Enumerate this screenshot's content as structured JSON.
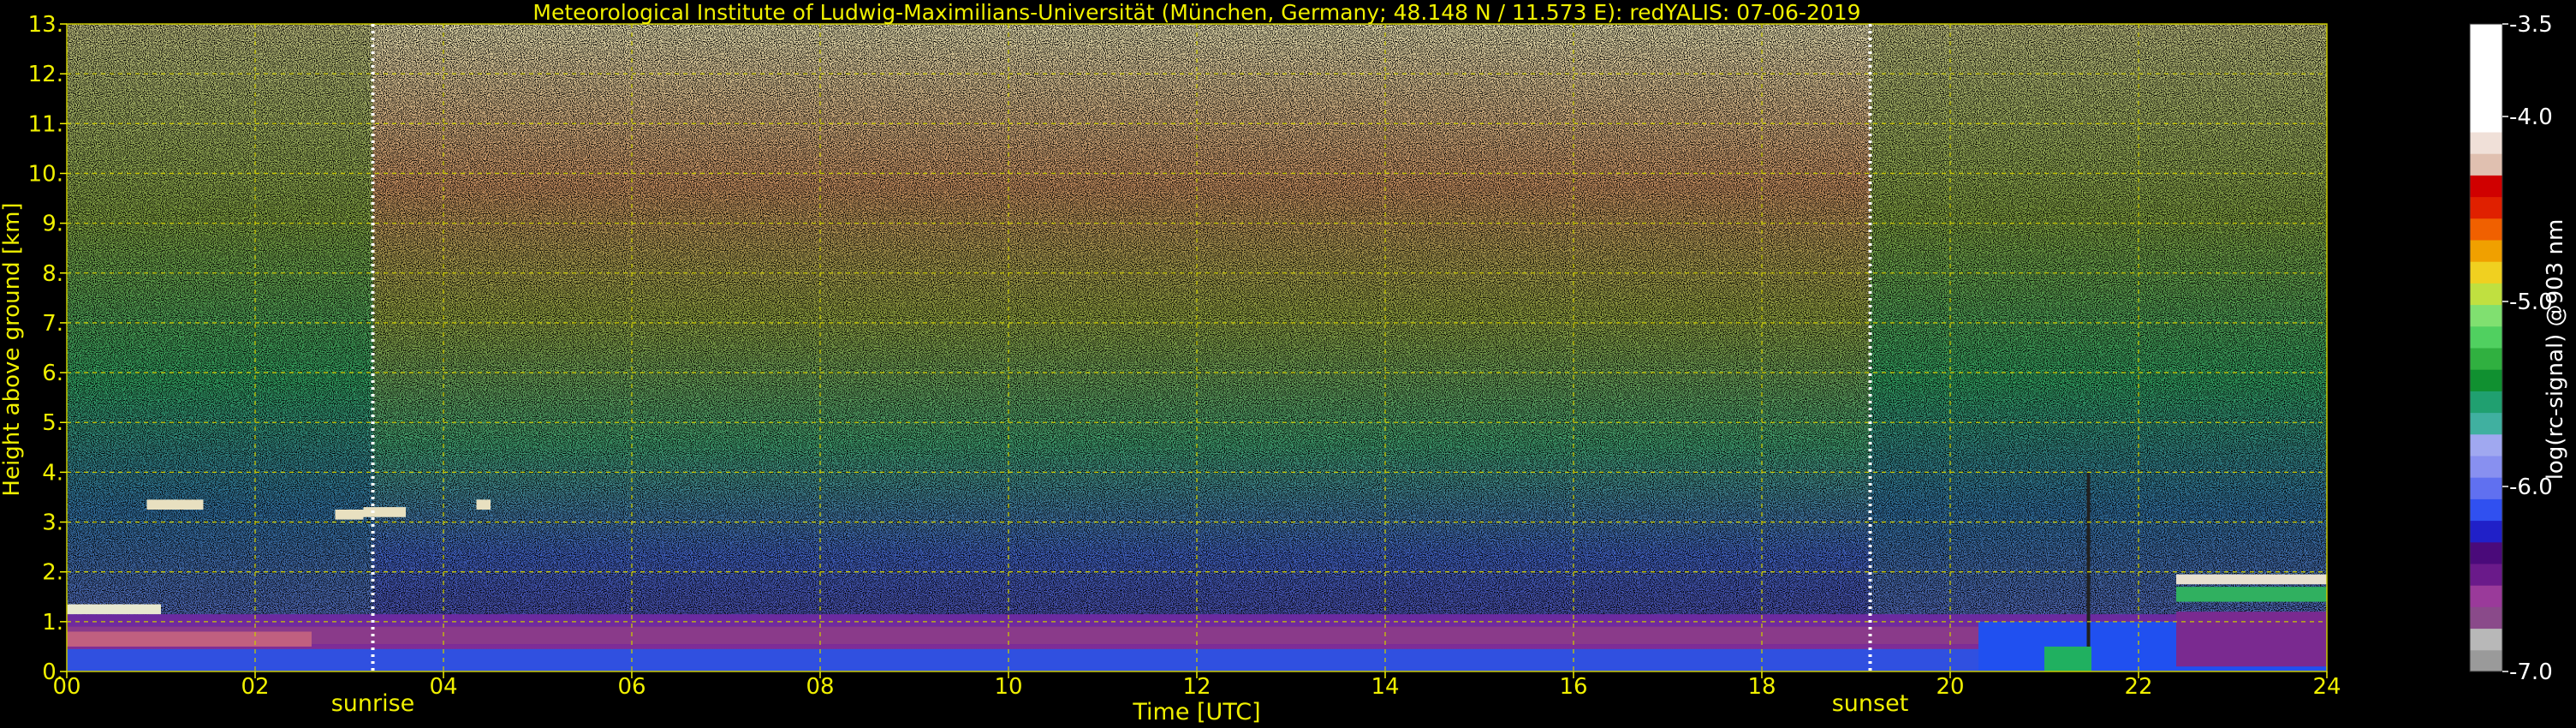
{
  "chart_data": {
    "type": "heatmap",
    "title": "Meteorological Institute of Ludwig-Maximilians-Universität (München, Germany; 48.148 N / 11.573 E):    redYALIS: 07-06-2019",
    "xlabel": "Time [UTC]",
    "ylabel": "Height above ground [km]",
    "xlim": [
      0,
      24
    ],
    "ylim": [
      0,
      13
    ],
    "x_ticks": [
      {
        "value": 0,
        "label": "00"
      },
      {
        "value": 2,
        "label": "02"
      },
      {
        "value": 4,
        "label": "04"
      },
      {
        "value": 6,
        "label": "06"
      },
      {
        "value": 8,
        "label": "08"
      },
      {
        "value": 10,
        "label": "10"
      },
      {
        "value": 12,
        "label": "12"
      },
      {
        "value": 14,
        "label": "14"
      },
      {
        "value": 16,
        "label": "16"
      },
      {
        "value": 18,
        "label": "18"
      },
      {
        "value": 20,
        "label": "20"
      },
      {
        "value": 22,
        "label": "22"
      },
      {
        "value": 24,
        "label": "24"
      }
    ],
    "y_ticks": [
      {
        "value": 0,
        "label": "0."
      },
      {
        "value": 1,
        "label": "1."
      },
      {
        "value": 2,
        "label": "2."
      },
      {
        "value": 3,
        "label": "3."
      },
      {
        "value": 4,
        "label": "4."
      },
      {
        "value": 5,
        "label": "5."
      },
      {
        "value": 6,
        "label": "6."
      },
      {
        "value": 7,
        "label": "7."
      },
      {
        "value": 8,
        "label": "8."
      },
      {
        "value": 9,
        "label": "9."
      },
      {
        "value": 10,
        "label": "10."
      },
      {
        "value": 11,
        "label": "11."
      },
      {
        "value": 12,
        "label": "12."
      },
      {
        "value": 13,
        "label": "13."
      }
    ],
    "grid": true,
    "grid_color": "#c8c800",
    "annotations": [
      {
        "text": "sunrise",
        "x": 3.25
      },
      {
        "text": "sunset",
        "x": 19.15
      }
    ],
    "colorbar": {
      "label": "log(rc-signal) @903 nm",
      "range": [
        -7.0,
        -3.5
      ],
      "ticks": [
        {
          "value": -3.5,
          "label": "-3.5"
        },
        {
          "value": -4.0,
          "label": "-4.0"
        },
        {
          "value": -5.0,
          "label": "-5.0"
        },
        {
          "value": -6.0,
          "label": "-6.0"
        },
        {
          "value": -7.0,
          "label": "-7.0"
        }
      ],
      "colors": [
        "#9a9a9a",
        "#b8b8b8",
        "#8a4a8a",
        "#9a3a9a",
        "#6a1a8a",
        "#4a0a7a",
        "#2020c8",
        "#3050f0",
        "#6070f0",
        "#8890f0",
        "#a0a8f0",
        "#40b0a0",
        "#20a070",
        "#109030",
        "#30b040",
        "#50d060",
        "#80e070",
        "#c0e040",
        "#f0d020",
        "#f0a000",
        "#f06000",
        "#e02000",
        "#d00000",
        "#e0c0b0",
        "#f0e0d8",
        "#ffffff",
        "#ffffff",
        "#ffffff",
        "#ffffff",
        "#ffffff"
      ]
    }
  },
  "colors": {
    "text": "#f0f000",
    "background": "#000000",
    "axis_text": "#f0f000",
    "colorbar_text": "#ffffff"
  }
}
